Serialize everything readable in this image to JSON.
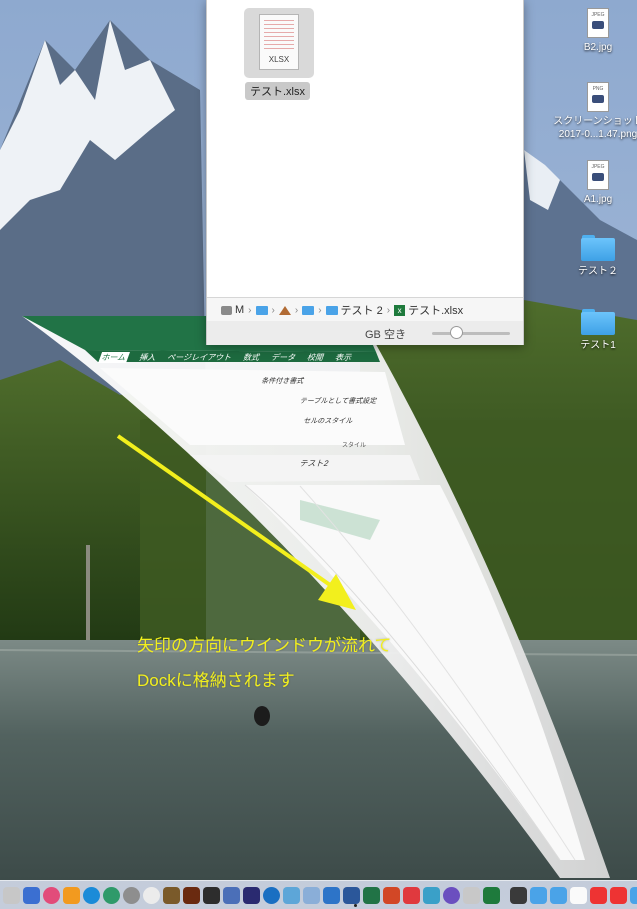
{
  "finder": {
    "file_label": "テスト.xlsx",
    "file_icon_ext": "XLSX",
    "path_items": [
      "M",
      "テスト 2",
      "テスト.xlsx"
    ],
    "status_text": "GB 空き"
  },
  "desktop_items": [
    {
      "label": "B2.jpg",
      "tag": "JPEG",
      "kind": "image"
    },
    {
      "label": "スクリーンショット",
      "label2": "2017-0...1.47.png",
      "tag": "PNG",
      "kind": "image"
    },
    {
      "label": "A1.jpg",
      "tag": "JPEG",
      "kind": "image"
    },
    {
      "label": "テスト２",
      "kind": "folder"
    },
    {
      "label": "テスト1",
      "kind": "folder"
    }
  ],
  "excel_window": {
    "ribbon_tabs": [
      "ホーム",
      "挿入",
      "ページレイアウト",
      "数式",
      "データ",
      "校閲",
      "表示"
    ],
    "ribbon_items": [
      "条件付き書式",
      "テーブルとして書式設定",
      "セルのスタイル"
    ],
    "group_label": "スタイル",
    "formula_bar": "テスト2"
  },
  "callout": {
    "line1": "矢印の方向にウインドウが流れて",
    "line2": "Dockに格納されます"
  },
  "colors": {
    "excel_green": "#217346",
    "arrow_yellow": "#f2ef1d",
    "folder_blue": "#4aa3e8"
  }
}
